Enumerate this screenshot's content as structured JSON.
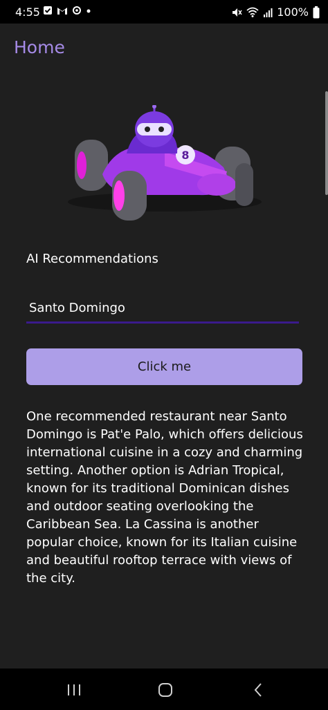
{
  "status_bar": {
    "time": "4:55",
    "battery": "100%",
    "left_icons": [
      "checkbox-icon",
      "gmail-icon",
      "sync-icon",
      "dot-icon"
    ],
    "right_icons": [
      "mute-icon",
      "wifi-icon",
      "signal-icon",
      "battery-icon"
    ]
  },
  "page": {
    "title": "Home"
  },
  "hero": {
    "image": "race-car-robot"
  },
  "form": {
    "label": "AI Recommendations",
    "entry_value": "Santo Domingo",
    "button_label": "Click me"
  },
  "result": {
    "text": "One recommended restaurant near Santo Domingo is Pat'e Palo, which offers delicious international cuisine in a cozy and charming setting. Another option is Adrian Tropical, known for its traditional Dominican dishes and outdoor seating overlooking the Caribbean Sea. La Cassina is another popular choice, known for its Italian cuisine and beautiful rooftop terrace with views of the city."
  },
  "nav": {
    "icons": [
      "recents-icon",
      "home-icon",
      "back-icon"
    ]
  },
  "colors": {
    "accent": "#a58ae6",
    "button_bg": "#ad9ee8",
    "underline": "#3a1a8c",
    "background": "#1f1f1f"
  }
}
